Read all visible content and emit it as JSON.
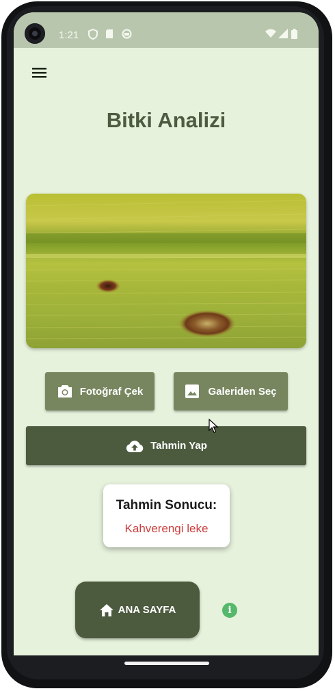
{
  "status_bar": {
    "time": "1:21"
  },
  "app": {
    "title": "Bitki Analizi"
  },
  "actions": {
    "camera_label": "Fotoğraf Çek",
    "gallery_label": "Galeriden Seç",
    "predict_label": "Tahmin Yap"
  },
  "result": {
    "title": "Tahmin Sonucu:",
    "value": "Kahverengi leke"
  },
  "nav": {
    "home_label": "ANA SAYFA"
  },
  "icons": {
    "menu": "menu-icon",
    "camera": "camera-icon",
    "gallery": "image-icon",
    "upload": "cloud-upload-icon",
    "home": "home-icon",
    "info": "info-icon"
  },
  "colors": {
    "background": "#e6f2dc",
    "title": "#4d5c40",
    "button_light": "#77865f",
    "button_dark": "#4c5a3e",
    "result_value": "#cc3f3f",
    "info": "#56b86a"
  }
}
